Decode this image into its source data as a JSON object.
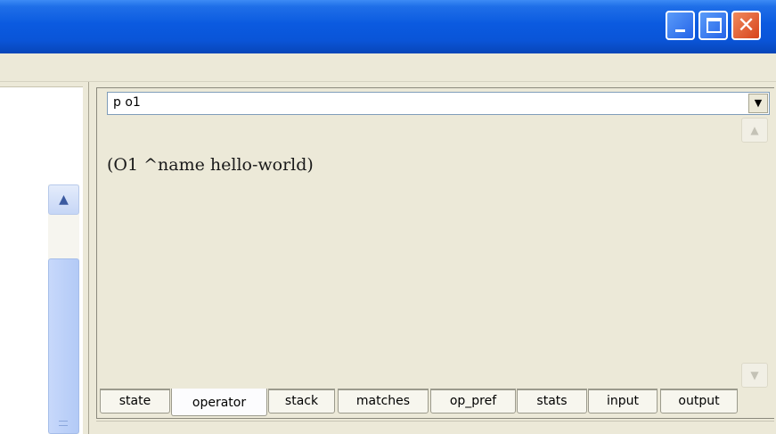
{
  "window": {
    "controls": {
      "minimize_icon": "minimize-icon",
      "maximize_icon": "maximize-icon",
      "close_icon": "close-icon",
      "close_glyph": "✕"
    },
    "accent_color": "#0a55d8",
    "close_color": "#d7431b"
  },
  "left_pane": {
    "scroll_up_glyph": "▲"
  },
  "command_combo": {
    "value": "p o1",
    "arrow_glyph": "▼"
  },
  "output": {
    "text": "(O1 ^name hello-world)"
  },
  "scrollbar": {
    "up_glyph": "▲",
    "down_glyph": "▼"
  },
  "tabs": [
    {
      "label": "state",
      "active": false
    },
    {
      "label": "operator",
      "active": true
    },
    {
      "label": "stack",
      "active": false
    },
    {
      "label": "matches",
      "active": false
    },
    {
      "label": "op_pref",
      "active": false
    },
    {
      "label": "stats",
      "active": false
    },
    {
      "label": "input",
      "active": false
    },
    {
      "label": "output",
      "active": false
    }
  ]
}
